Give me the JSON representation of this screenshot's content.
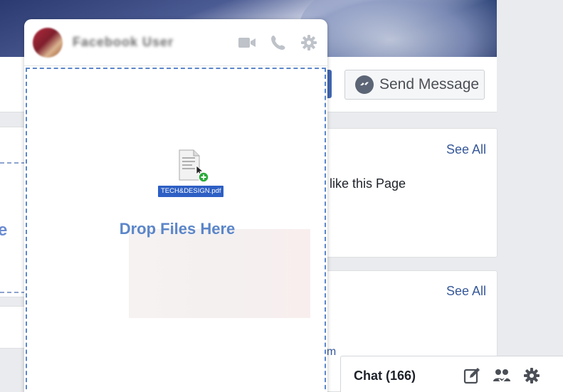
{
  "chat_tab": {
    "contact_name": "Facebook User",
    "drop_label": "Drop Files Here",
    "file_name": "TECH&DESIGN.pdf",
    "file_type": "PDF",
    "icons": [
      "video-call-icon",
      "phone-icon",
      "gear-icon"
    ]
  },
  "page": {
    "send_message_label": "Send Message",
    "see_all_1": "See All",
    "see_all_2": "See All",
    "like_text": "o like this Page",
    "partial_link": "om",
    "partial_left_char": "e"
  },
  "chat_bar": {
    "title": "Chat (166)",
    "icons": [
      "compose-icon",
      "group-icon",
      "gear-icon"
    ]
  },
  "colors": {
    "facebook_blue": "#4267b2",
    "link_blue": "#365899",
    "drop_blue": "#5b86c9",
    "icon_gray": "#bec2c9",
    "bar_icon_dark": "#4b4f56"
  }
}
